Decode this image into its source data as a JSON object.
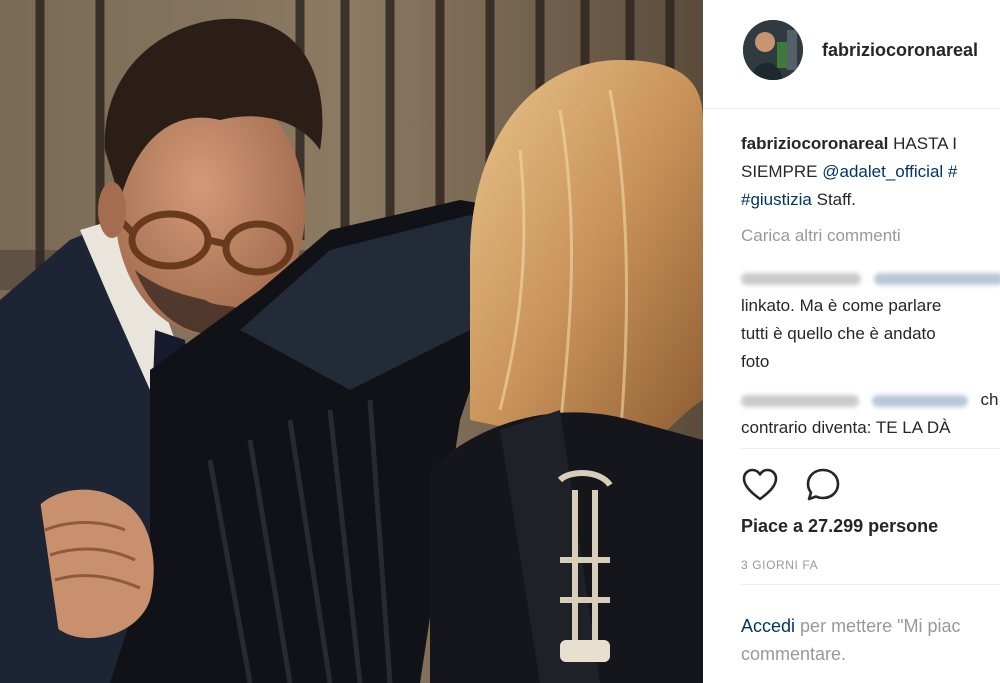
{
  "post": {
    "username": "fabriziocoronareal",
    "caption": {
      "username": "fabriziocoronareal",
      "line1_text": "HASTA I",
      "line2_text": "SIEMPRE",
      "mention": "@adalet_official",
      "line2_tag": "#",
      "line3_tag": "#giustizia",
      "line3_text": "Staff."
    },
    "load_more": "Carica altri commenti",
    "comments": [
      {
        "line1": "linkato. Ma è come parlare",
        "line2": "tutti è quello che è andato",
        "line3": "foto"
      },
      {
        "suffix": "ch",
        "line2": "contrario diventa: TE LA DÀ"
      }
    ],
    "likes": "Piace a 27.299 persone",
    "date": "3 GIORNI FA",
    "login": {
      "link": "Accedi",
      "text": "per mettere \"Mi piac",
      "text2": "commentare."
    }
  },
  "icons": {
    "like": "heart-icon",
    "comment": "comment-bubble-icon"
  },
  "colors": {
    "link": "#003569",
    "muted": "#999999",
    "text": "#262626",
    "divider": "#efefef"
  }
}
